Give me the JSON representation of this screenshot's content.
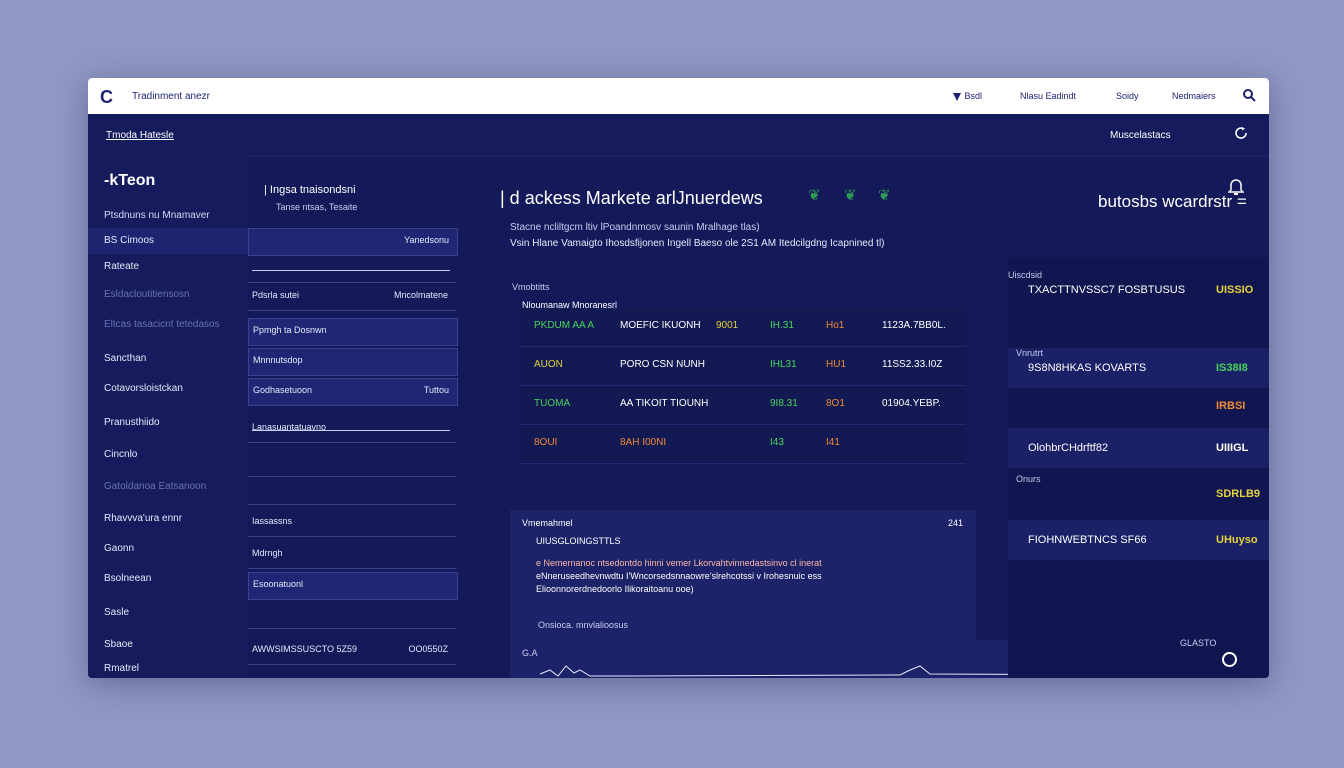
{
  "window": {
    "logo": "C",
    "title": "Tradinment anezr",
    "nav": [
      {
        "label": "Bsdl",
        "icon": "cursor-icon"
      },
      {
        "label": "Nlasu Eadindt"
      },
      {
        "label": "Soidy"
      },
      {
        "label": "Nedmaiers"
      }
    ],
    "search_icon": "search-icon"
  },
  "subbar": {
    "breadcrumb": "Tmoda Hatesle",
    "account": "Muscelastacs",
    "refresh_icon": "refresh-icon"
  },
  "sidebar": {
    "brand": "-kTeon",
    "subtitle": "Ptsdnuns nu Mnamaver",
    "items": [
      {
        "label": "BS Cimoos",
        "active": true
      },
      {
        "label": "Rateate"
      },
      {
        "label": "Esldacloutitiensosn",
        "dim": true
      },
      {
        "label": "Eltcas tasacicnt tetedasos",
        "dim": true
      },
      {
        "label": "Sancthan"
      },
      {
        "label": "Cotavorsloistckan"
      },
      {
        "label": "Pranusthiido"
      },
      {
        "label": "Cincnlo"
      },
      {
        "label": "Gatoldanoa Eatsanoon",
        "dim": true
      },
      {
        "label": "Rhavvva'ura ennr"
      },
      {
        "label": "Gaonn"
      },
      {
        "label": "Bsolneean"
      },
      {
        "label": "Sasle"
      },
      {
        "label": "Sbaoe"
      },
      {
        "label": "Rmatrel"
      }
    ]
  },
  "midcol": {
    "header": "| Ingsa tnaisondsni",
    "subheader": "Tanse ntsas, Tesaite",
    "rows": [
      {
        "label": "",
        "value": "Yanedsonu",
        "boxed": true
      },
      {
        "label": "",
        "value": "",
        "line": true
      },
      {
        "label": "Pdsrla sutei",
        "value": "Mncolmatene"
      },
      {
        "label": "Ppmgh ta Dosnwn",
        "value": "",
        "boxed": true
      },
      {
        "label": "Mnnnutsdop",
        "value": "",
        "boxed": true
      },
      {
        "label": "Godhasetuoon",
        "value": "Tuttou",
        "boxed": true
      },
      {
        "label": "Lanasuantatuavno",
        "value": "",
        "line": true
      },
      {
        "label": "",
        "value": ""
      },
      {
        "label": "",
        "value": ""
      },
      {
        "label": "Iassassns",
        "value": ""
      },
      {
        "label": "Mdrngh",
        "value": ""
      },
      {
        "label": "Esoonatuonl",
        "value": "",
        "boxed": true
      },
      {
        "label": "",
        "value": ""
      },
      {
        "label": "AWWSIMSSUSCTO 5Z59",
        "value": "OO0550Z"
      }
    ]
  },
  "main": {
    "title": "| d ackess Markete arlJnuerdews",
    "icons": [
      "leaf-icon",
      "leaf-icon",
      "leaf-icon"
    ],
    "desc1": "Stacne  ncliltgcm ltiv lPoandnmosv saunin Mralhage tlas)",
    "desc2": "Vsin Hlane Vamaigto Ihosdsfijonen Ingell Baeso ole 2S1 AM Itedcilgdng Icapnined tl)",
    "table_title": "Vmobtitts",
    "table_subtitle": "Nloumanaw Mnoranesrl",
    "rows": [
      {
        "c1": "PKDUM AA A",
        "c2": "MOEFIC IKUONH",
        "c3": "9001",
        "c4": "IH.31",
        "c5": "Ho1",
        "c6": "1123A.7BB0L."
      },
      {
        "c1": "AUON",
        "c2": "PORO CSN NUNH",
        "c3": "",
        "c4": "IHL31",
        "c5": "HU1",
        "c6": "11SS2.33.I0Z"
      },
      {
        "c1": "TUOMA",
        "c2": "AA TIKOIT TIOUNH",
        "c3": "",
        "c4": "9I8.31",
        "c5": "8O1",
        "c6": "01904.YEBP."
      },
      {
        "c1": "8OUI",
        "c2": "8AH I00NI",
        "c3": "",
        "c4": "I43",
        "c5": "I41",
        "c6": ""
      }
    ],
    "panel": {
      "header": "Vmemahmel",
      "count": "241",
      "sub": "UIUSGLOINGSTTLS",
      "lines": [
        "e Nemernanoc ntsedontdo hinni vemer Lkorvahtvinnedastsinvo cl inerat",
        "eNneruseedhevnwdtu I'Wncorsedsnnaowre'slrehcotssi v Irohesnuic ess",
        "Elioonnorerdnedoorlo Ilikoraitoanu ooe)"
      ],
      "footer": "Onsioca. mnvlalioosus"
    },
    "chart_label": "G.A"
  },
  "right": {
    "title": "butosbs wcardrstr =",
    "corner_icon": "bell-icon",
    "section": "Uiscdsid",
    "rows": [
      {
        "label": "TXACTTNVSSC7 FOSBTUSUS",
        "value": "UISSIO",
        "tag": ""
      },
      {
        "label": "9S8N8HKAS KOVARTS",
        "value": "IS38I8",
        "tag": "Vnrutrt"
      },
      {
        "label": "",
        "value": "IRBSI",
        "tag": ""
      },
      {
        "label": "OlohbrCHdrftf82",
        "value": "UIIIGL",
        "tag": ""
      },
      {
        "label": "",
        "value": "SDRLB9",
        "tag": "Onurs"
      },
      {
        "label": "FIOHNWEBTNCS SF66",
        "value": "UHuyso",
        "tag": ""
      }
    ],
    "footer": "GLASTO",
    "clock_icon": "clock-icon"
  },
  "colors": {
    "bg": "#8f97c2",
    "panel": "#14195a",
    "green": "#47d35a",
    "orange": "#f08a35",
    "yellow": "#e3d23b",
    "pink": "#ff6b8a"
  }
}
